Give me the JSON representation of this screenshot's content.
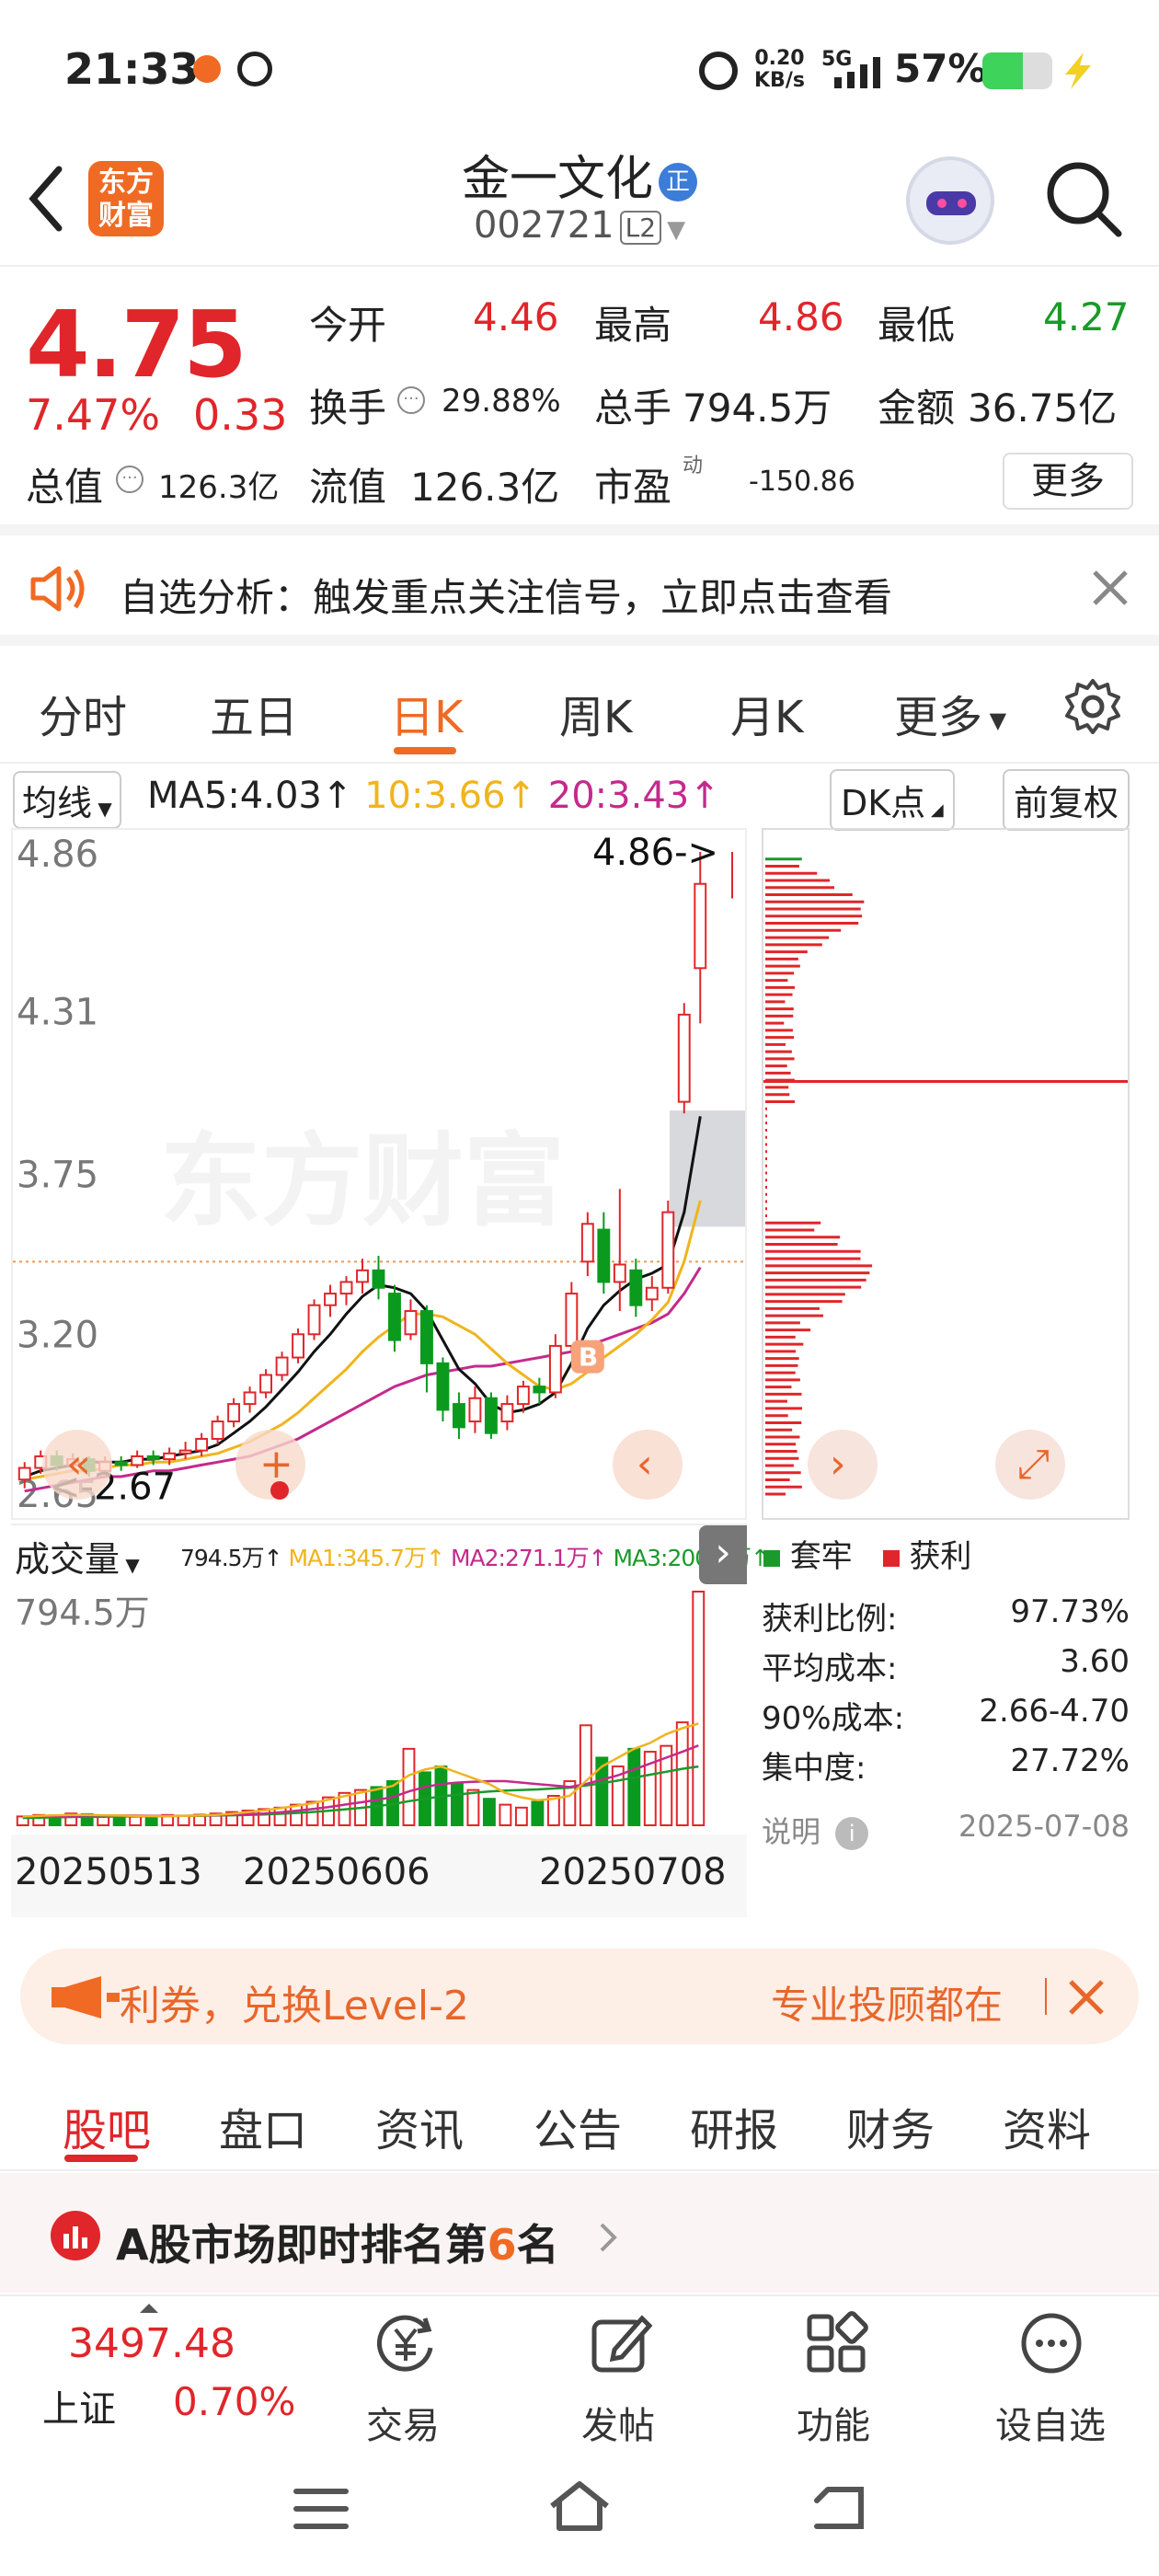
{
  "status": {
    "time": "21:33",
    "net_speed_top": "0.20",
    "net_speed_bottom": "KB/s",
    "signal": "5G",
    "battery": "57%"
  },
  "header": {
    "logo_top": "东方",
    "logo_bottom": "财富",
    "name": "金一文化",
    "name_badge": "正",
    "code": "002721",
    "level": "L2"
  },
  "quote": {
    "price": "4.75",
    "change_pct": "7.47%",
    "change": "0.33",
    "open_label": "今开",
    "open": "4.46",
    "high_label": "最高",
    "high": "4.86",
    "low_label": "最低",
    "low": "4.27",
    "turnover_label": "换手",
    "turnover": "29.88%",
    "volume_label": "总手",
    "volume": "794.5万",
    "amount_label": "金额",
    "amount": "36.75亿",
    "total_cap_label": "总值",
    "total_cap": "126.3亿",
    "float_cap_label": "流值",
    "float_cap": "126.3亿",
    "pe_label": "市盈",
    "pe_sup": "动",
    "pe": "-150.86",
    "more_button": "更多"
  },
  "banner": {
    "text": "自选分析：触发重点关注信号，立即点击查看"
  },
  "tabs": [
    "分时",
    "五日",
    "日K",
    "周K",
    "月K",
    "更多"
  ],
  "chart_toolbar": {
    "ma_select": "均线",
    "ma5": "MA5:4.03",
    "ma10": "10:3.66",
    "ma20": "20:3.43",
    "dk": "DK点",
    "fq": "前复权"
  },
  "chart_data": {
    "type": "candlestick",
    "yticks": [
      "4.86",
      "4.31",
      "3.75",
      "3.20",
      "2.65"
    ],
    "ylim": [
      2.65,
      4.86
    ],
    "max_label": "4.86->",
    "min_label": "<-2.67",
    "marker": "B",
    "candles": [
      [
        2.7,
        2.74,
        2.67,
        2.76
      ],
      [
        2.74,
        2.78,
        2.72,
        2.8
      ],
      [
        2.78,
        2.75,
        2.73,
        2.8
      ],
      [
        2.75,
        2.77,
        2.73,
        2.79
      ],
      [
        2.77,
        2.73,
        2.71,
        2.78
      ],
      [
        2.73,
        2.76,
        2.72,
        2.78
      ],
      [
        2.76,
        2.75,
        2.73,
        2.78
      ],
      [
        2.75,
        2.78,
        2.74,
        2.8
      ],
      [
        2.78,
        2.77,
        2.75,
        2.8
      ],
      [
        2.77,
        2.79,
        2.75,
        2.81
      ],
      [
        2.79,
        2.8,
        2.77,
        2.83
      ],
      [
        2.8,
        2.84,
        2.78,
        2.86
      ],
      [
        2.84,
        2.9,
        2.82,
        2.92
      ],
      [
        2.9,
        2.96,
        2.88,
        2.98
      ],
      [
        2.96,
        3.0,
        2.93,
        3.02
      ],
      [
        3.0,
        3.06,
        2.98,
        3.08
      ],
      [
        3.06,
        3.12,
        3.04,
        3.14
      ],
      [
        3.12,
        3.2,
        3.1,
        3.22
      ],
      [
        3.2,
        3.3,
        3.18,
        3.32
      ],
      [
        3.3,
        3.34,
        3.26,
        3.37
      ],
      [
        3.34,
        3.38,
        3.3,
        3.4
      ],
      [
        3.38,
        3.42,
        3.34,
        3.46
      ],
      [
        3.42,
        3.36,
        3.32,
        3.47
      ],
      [
        3.34,
        3.18,
        3.14,
        3.37
      ],
      [
        3.2,
        3.28,
        3.18,
        3.32
      ],
      [
        3.28,
        3.1,
        3.0,
        3.3
      ],
      [
        3.1,
        2.94,
        2.9,
        3.12
      ],
      [
        2.96,
        2.88,
        2.84,
        3.0
      ],
      [
        2.9,
        2.98,
        2.86,
        3.02
      ],
      [
        2.98,
        2.86,
        2.84,
        3.0
      ],
      [
        2.9,
        2.96,
        2.87,
        2.99
      ],
      [
        2.96,
        3.02,
        2.93,
        3.04
      ],
      [
        3.02,
        3.0,
        2.96,
        3.05
      ],
      [
        3.0,
        3.16,
        2.98,
        3.2
      ],
      [
        3.16,
        3.34,
        3.14,
        3.38
      ],
      [
        3.45,
        3.58,
        3.4,
        3.62
      ],
      [
        3.56,
        3.38,
        3.34,
        3.62
      ],
      [
        3.38,
        3.44,
        3.28,
        3.7
      ],
      [
        3.42,
        3.3,
        3.26,
        3.46
      ],
      [
        3.32,
        3.36,
        3.28,
        3.4
      ],
      [
        3.36,
        3.62,
        3.34,
        3.66
      ],
      [
        4.0,
        4.3,
        3.96,
        4.34
      ],
      [
        4.46,
        4.75,
        4.27,
        4.86
      ]
    ],
    "ma5": [
      2.71,
      2.73,
      2.74,
      2.75,
      2.76,
      2.76,
      2.76,
      2.77,
      2.77,
      2.78,
      2.79,
      2.8,
      2.82,
      2.86,
      2.9,
      2.95,
      3.01,
      3.07,
      3.14,
      3.2,
      3.27,
      3.33,
      3.37,
      3.36,
      3.34,
      3.28,
      3.18,
      3.08,
      3.03,
      2.96,
      2.93,
      2.94,
      2.96,
      3.0,
      3.1,
      3.22,
      3.3,
      3.35,
      3.39,
      3.41,
      3.44,
      3.62,
      3.95
    ],
    "ma10": [
      2.7,
      2.71,
      2.72,
      2.73,
      2.73,
      2.74,
      2.75,
      2.75,
      2.76,
      2.76,
      2.77,
      2.78,
      2.79,
      2.81,
      2.83,
      2.86,
      2.89,
      2.93,
      2.98,
      3.03,
      3.08,
      3.14,
      3.19,
      3.23,
      3.27,
      3.27,
      3.26,
      3.23,
      3.2,
      3.15,
      3.1,
      3.06,
      3.02,
      3.01,
      3.03,
      3.07,
      3.12,
      3.16,
      3.2,
      3.25,
      3.31,
      3.45,
      3.66
    ],
    "ma20": [
      2.66,
      2.67,
      2.68,
      2.69,
      2.7,
      2.71,
      2.71,
      2.72,
      2.73,
      2.73,
      2.74,
      2.75,
      2.76,
      2.77,
      2.78,
      2.8,
      2.82,
      2.84,
      2.87,
      2.9,
      2.93,
      2.96,
      2.99,
      3.02,
      3.04,
      3.06,
      3.07,
      3.08,
      3.09,
      3.09,
      3.1,
      3.11,
      3.12,
      3.13,
      3.14,
      3.16,
      3.18,
      3.2,
      3.22,
      3.24,
      3.27,
      3.34,
      3.43
    ],
    "volume_label": "成交量",
    "volume_text": "794.5万",
    "vol_ma1": "MA1:345.7万",
    "vol_ma2": "MA2:271.1万",
    "vol_ma3": "MA3:200.0万",
    "volume_ymax_label": "794.5万",
    "volumes": [
      30,
      35,
      32,
      40,
      38,
      30,
      28,
      32,
      30,
      35,
      33,
      36,
      40,
      45,
      50,
      55,
      60,
      70,
      80,
      95,
      110,
      120,
      130,
      150,
      260,
      180,
      200,
      140,
      120,
      90,
      70,
      60,
      80,
      100,
      150,
      340,
      230,
      200,
      260,
      250,
      270,
      350,
      794.5
    ],
    "vol_ma1_line": [
      30,
      32,
      34,
      35,
      35,
      34,
      33,
      32,
      31,
      31,
      32,
      33,
      35,
      39,
      45,
      51,
      58,
      66,
      75,
      87,
      99,
      111,
      122,
      134,
      170,
      190,
      200,
      180,
      160,
      140,
      110,
      95,
      85,
      90,
      100,
      150,
      200,
      230,
      260,
      280,
      310,
      330,
      345.7
    ],
    "vol_ma2_line": [
      28,
      30,
      31,
      32,
      33,
      33,
      33,
      33,
      32,
      32,
      32,
      33,
      34,
      35,
      38,
      40,
      44,
      49,
      55,
      62,
      70,
      78,
      86,
      96,
      115,
      130,
      140,
      145,
      148,
      150,
      150,
      145,
      140,
      135,
      130,
      140,
      155,
      170,
      190,
      210,
      230,
      250,
      271.1
    ],
    "vol_ma3_line": [
      25,
      26,
      27,
      28,
      29,
      29,
      30,
      30,
      31,
      31,
      32,
      32,
      33,
      34,
      35,
      37,
      39,
      42,
      45,
      49,
      54,
      59,
      65,
      72,
      82,
      90,
      98,
      104,
      110,
      115,
      118,
      120,
      122,
      125,
      128,
      135,
      143,
      152,
      162,
      172,
      182,
      192,
      200.0
    ],
    "dates": [
      "20250513",
      "20250606",
      "20250708"
    ]
  },
  "cyq": {
    "legend_a": "套牢",
    "legend_b": "获利",
    "profit_ratio_label": "获利比例:",
    "profit_ratio": "97.73%",
    "avg_cost_label": "平均成本:",
    "avg_cost": "3.60",
    "cost90_label": "90%成本:",
    "cost90": "2.66-4.70",
    "concentration_label": "集中度:",
    "concentration": "27.72%",
    "note_label": "说明",
    "date": "2025-07-08"
  },
  "promo": {
    "text_left": "利券，兑换Level-2",
    "text_right": "专业投顾都在"
  },
  "subtabs": [
    "股吧",
    "盘口",
    "资讯",
    "公告",
    "研报",
    "财务",
    "资料"
  ],
  "rank": {
    "prefix": "A股市场即时排名第",
    "rank": "6",
    "suffix": "名"
  },
  "bottom": {
    "index_value": "3497.48",
    "index_name": "上证",
    "index_change": "0.70%",
    "trade": "交易",
    "post": "发帖",
    "func": "功能",
    "watch": "设自选"
  }
}
